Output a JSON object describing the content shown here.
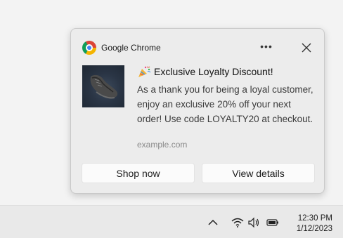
{
  "notification": {
    "app_name": "Google Chrome",
    "more_label": "•••",
    "title": "Exclusive Loyalty Discount!",
    "body": "As a thank you for being a loyal customer, enjoy an exclusive 20% off your next order! Use code LOYALTY20 at checkout.",
    "source": "example.com",
    "actions": [
      {
        "label": "Shop now"
      },
      {
        "label": "View details"
      }
    ],
    "icons": {
      "app": "chrome-logo-icon",
      "title": "party-popper-icon",
      "more": "more-options-icon",
      "close": "close-icon",
      "image": "shoe-photo"
    }
  },
  "taskbar": {
    "time": "12:30 PM",
    "date": "1/12/2023",
    "icons": [
      "chevron-up-icon",
      "wifi-icon",
      "volume-icon",
      "battery-icon"
    ]
  }
}
